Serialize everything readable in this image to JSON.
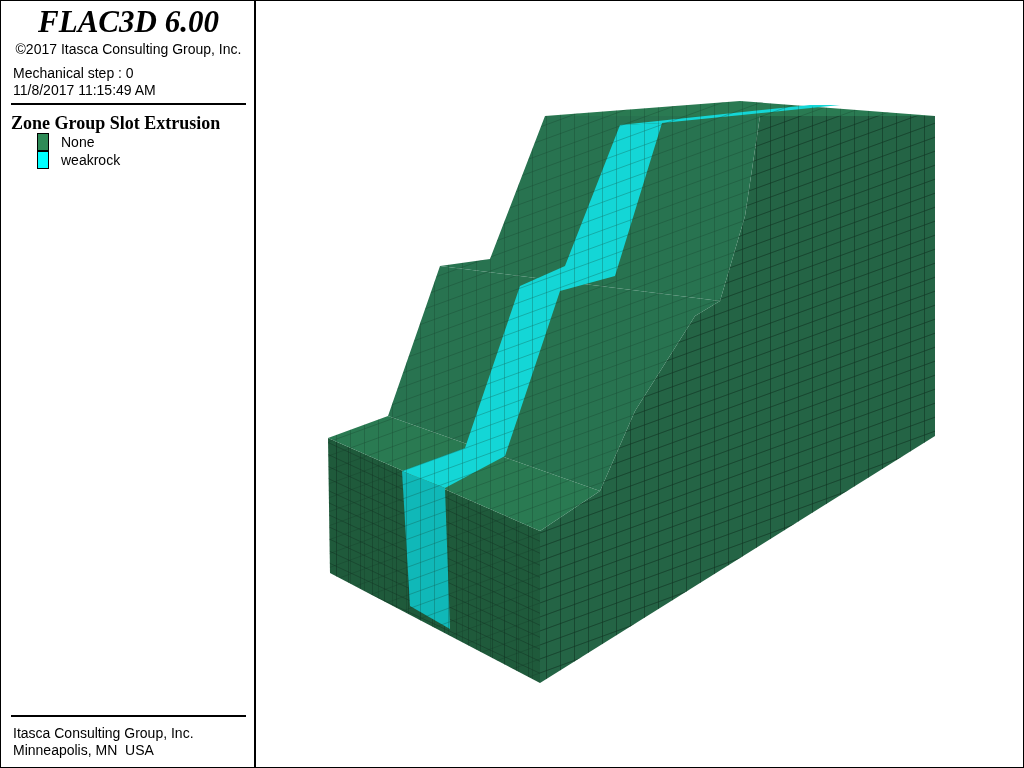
{
  "legend_panel": {
    "title": "FLAC3D 6.00",
    "copyright": "©2017 Itasca Consulting Group, Inc.",
    "step": "Mechanical step : 0",
    "timestamp": "11/8/2017 11:15:49 AM",
    "legend_title": "Zone Group Slot Extrusion",
    "items": [
      {
        "label": "None",
        "color": "#2e8b57"
      },
      {
        "label": "weakrock",
        "color": "#00ffff"
      }
    ],
    "footer": [
      "Itasca Consulting Group, Inc.",
      "Minneapolis, MN  USA"
    ]
  }
}
